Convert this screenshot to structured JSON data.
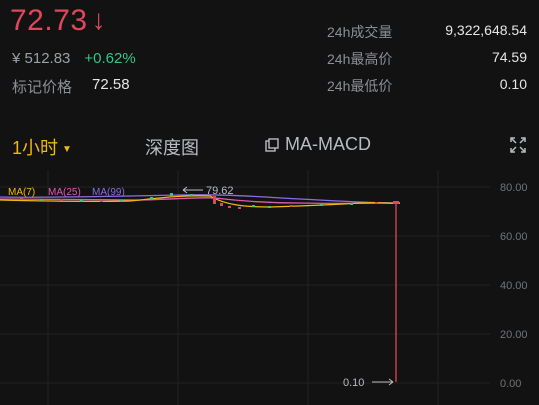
{
  "header": {
    "last_price": "72.73",
    "cny_price": "¥  512.83",
    "change_pct": "+0.62%",
    "mark_label": "标记价格",
    "mark_price": "72.58"
  },
  "stats": [
    {
      "label": "24h成交量",
      "value": "9,322,648.54"
    },
    {
      "label": "24h最高价",
      "value": "74.59"
    },
    {
      "label": "24h最低价",
      "value": "0.10"
    }
  ],
  "tabs": {
    "interval": "1小时",
    "depth": "深度图",
    "indicator": "MA-MACD"
  },
  "chart": {
    "legend": [
      "MA(7)",
      "MA(25)",
      "MA(99)"
    ],
    "high_marker": "79.62",
    "low_marker": "0.10",
    "y_ticks": [
      "80.00",
      "60.00",
      "40.00",
      "20.00",
      "0.00"
    ],
    "colors": {
      "up": "#35c48a",
      "down": "#e0475a",
      "ma7": "#f0b90b",
      "ma25": "#e05ab5",
      "ma99": "#8a6ee0"
    }
  }
}
